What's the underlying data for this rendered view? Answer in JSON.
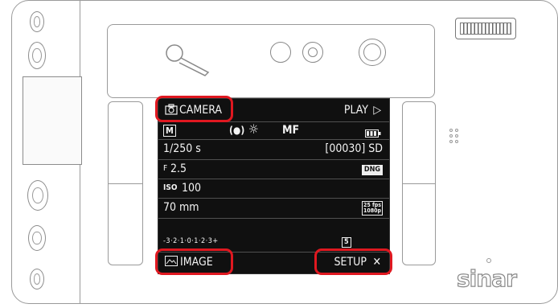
{
  "screen": {
    "camera_label": "CAMERA",
    "play_label": "PLAY",
    "play_glyph": "▷",
    "mode": "M",
    "metering_glyph": "(●)",
    "wb_glyph": "☼",
    "focus_mode": "MF",
    "shutter": "1/250 s",
    "shots": "[00030] SD",
    "aperture_prefix": "F",
    "aperture": "2.5",
    "format": "DNG",
    "iso_label": "ISO",
    "iso": "100",
    "focal": "70 mm",
    "video_fps": "25 fps",
    "video_res": "1080p",
    "exposure_scale": "-3·2·1·0·1·2·3+",
    "bracket_count": "5",
    "image_label": "IMAGE",
    "setup_label": "SETUP",
    "setup_glyph": "✕"
  },
  "body": {
    "brand": "sinar"
  },
  "colors": {
    "screen_bg": "#101010",
    "highlight": "#e01820",
    "text": "#f4f4f4"
  }
}
